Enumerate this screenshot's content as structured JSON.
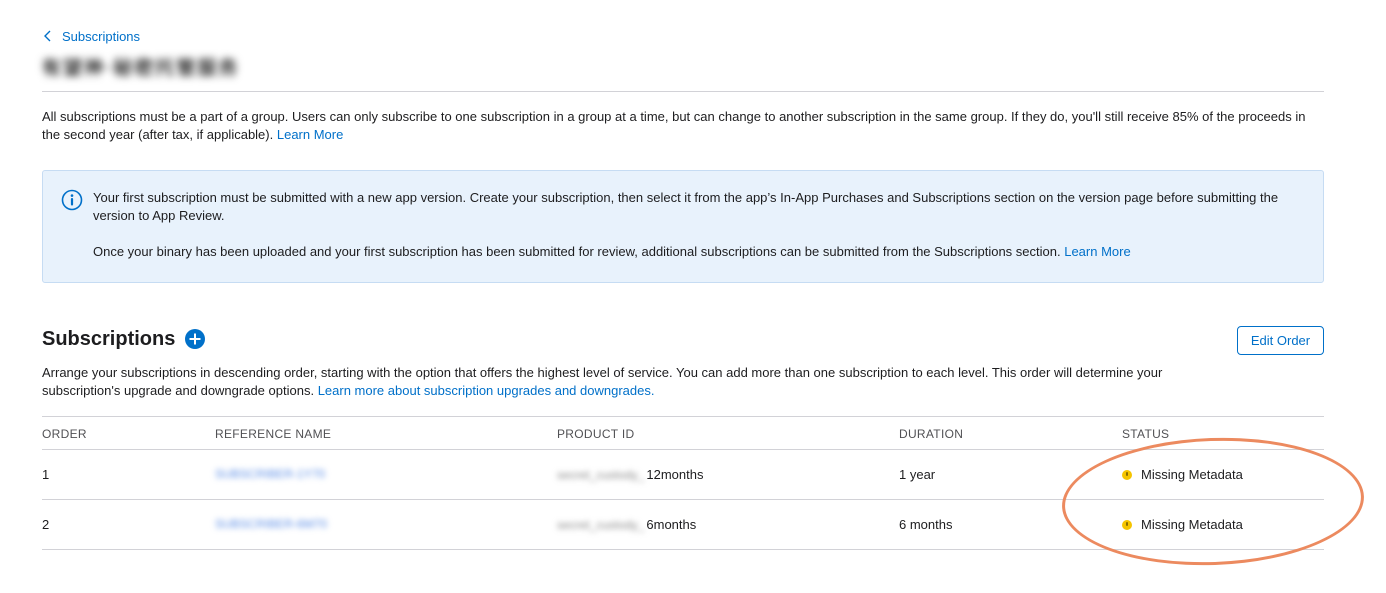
{
  "breadcrumb": {
    "back_label": "Subscriptions"
  },
  "group_title": "有望神·秘密托管服务",
  "intro": {
    "text": "All subscriptions must be a part of a group. Users can only subscribe to one subscription in a group at a time, but can change to another subscription in the same group. If they do, you'll still receive 85% of the proceeds in the second year (after tax, if applicable).",
    "link": "Learn More"
  },
  "notice": {
    "p1": "Your first subscription must be submitted with a new app version. Create your subscription, then select it from the app’s In-App Purchases and Subscriptions section on the version page before submitting the version to App Review.",
    "p2": "Once your binary has been uploaded and your first subscription has been submitted for review, additional subscriptions can be submitted from the Subscriptions section.",
    "link": "Learn More"
  },
  "section": {
    "title": "Subscriptions",
    "edit_order_label": "Edit Order",
    "desc": "Arrange your subscriptions in descending order, starting with the option that offers the highest level of service. You can add more than one subscription to each level. This order will determine your subscription's upgrade and downgrade options.",
    "desc_link": "Learn more about subscription upgrades and downgrades."
  },
  "table": {
    "headers": {
      "order": "ORDER",
      "reference_name": "REFERENCE NAME",
      "product_id": "PRODUCT ID",
      "duration": "DURATION",
      "status": "STATUS"
    },
    "rows": [
      {
        "order": "1",
        "reference_name": "SUBSCRIBER-1Y70",
        "product_id_prefix": "secret_custody_",
        "product_id_suffix": "12months",
        "duration": "1 year",
        "status": "Missing Metadata"
      },
      {
        "order": "2",
        "reference_name": "SUBSCRIBER-6M70",
        "product_id_prefix": "secret_custody_",
        "product_id_suffix": "6months",
        "duration": "6 months",
        "status": "Missing Metadata"
      }
    ]
  },
  "colors": {
    "link": "#0070c9",
    "notice_bg": "#e8f2fc",
    "status_warning": "#f5c400",
    "annotation_ring": "#ec8a5f"
  },
  "icons": {
    "back": "chevron-left-icon",
    "info": "info-circle-icon",
    "add": "plus-circle-icon",
    "status": "warning-dot-icon"
  }
}
